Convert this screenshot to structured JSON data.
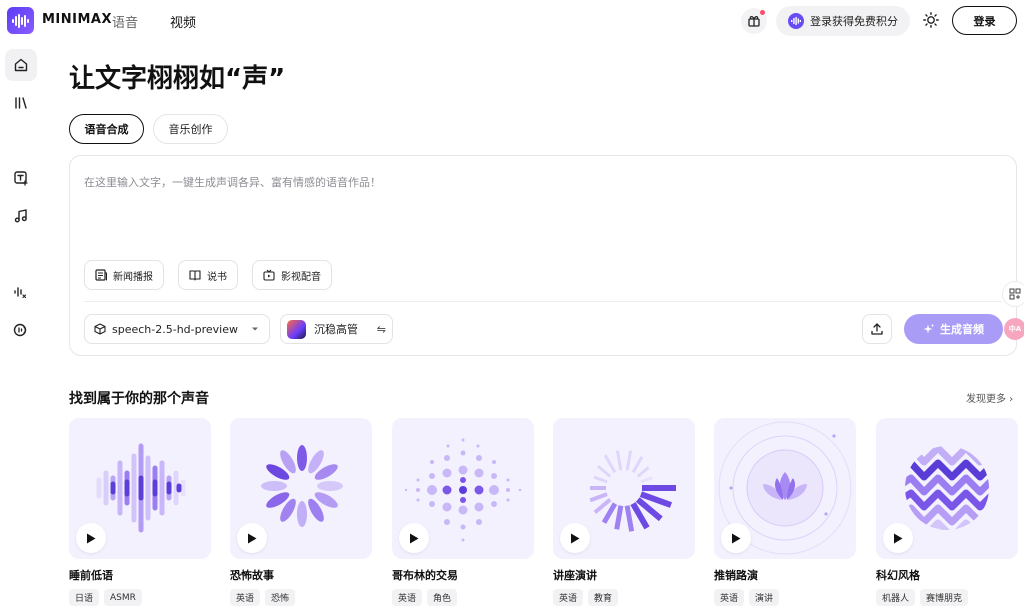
{
  "topbar": {
    "brand": "MINIMAX",
    "nav_voice": "语音",
    "nav_video": "视频",
    "promo": "登录获得免费积分",
    "login": "登录"
  },
  "hero": {
    "title": "让文字栩栩如“声”"
  },
  "tabs": [
    {
      "label": "语音合成",
      "active": true
    },
    {
      "label": "音乐创作",
      "active": false
    }
  ],
  "editor": {
    "placeholder": "在这里输入文字，一键生成声调各异、富有情感的语音作品！",
    "chips": [
      "新闻播报",
      "说书",
      "影视配音"
    ],
    "model": "speech-2.5-hd-preview",
    "voice": "沉稳高管",
    "generate": "生成音频"
  },
  "float": {
    "lang": "中A"
  },
  "section": {
    "title": "找到属于你的那个声音",
    "more": "发现更多 ›"
  },
  "cards": [
    {
      "title": "睡前低语",
      "tags": [
        "日语",
        "ASMR"
      ]
    },
    {
      "title": "恐怖故事",
      "tags": [
        "英语",
        "恐怖"
      ]
    },
    {
      "title": "哥布林的交易",
      "tags": [
        "英语",
        "角色"
      ]
    },
    {
      "title": "讲座演讲",
      "tags": [
        "英语",
        "教育"
      ]
    },
    {
      "title": "推销路演",
      "tags": [
        "英语",
        "演讲"
      ]
    },
    {
      "title": "科幻风格",
      "tags": [
        "机器人",
        "赛博朋克"
      ]
    }
  ],
  "colors": {
    "accent": "#6a4cf6",
    "generate_bg": "#a99cf6",
    "card_bg": "#f4f1fe"
  }
}
